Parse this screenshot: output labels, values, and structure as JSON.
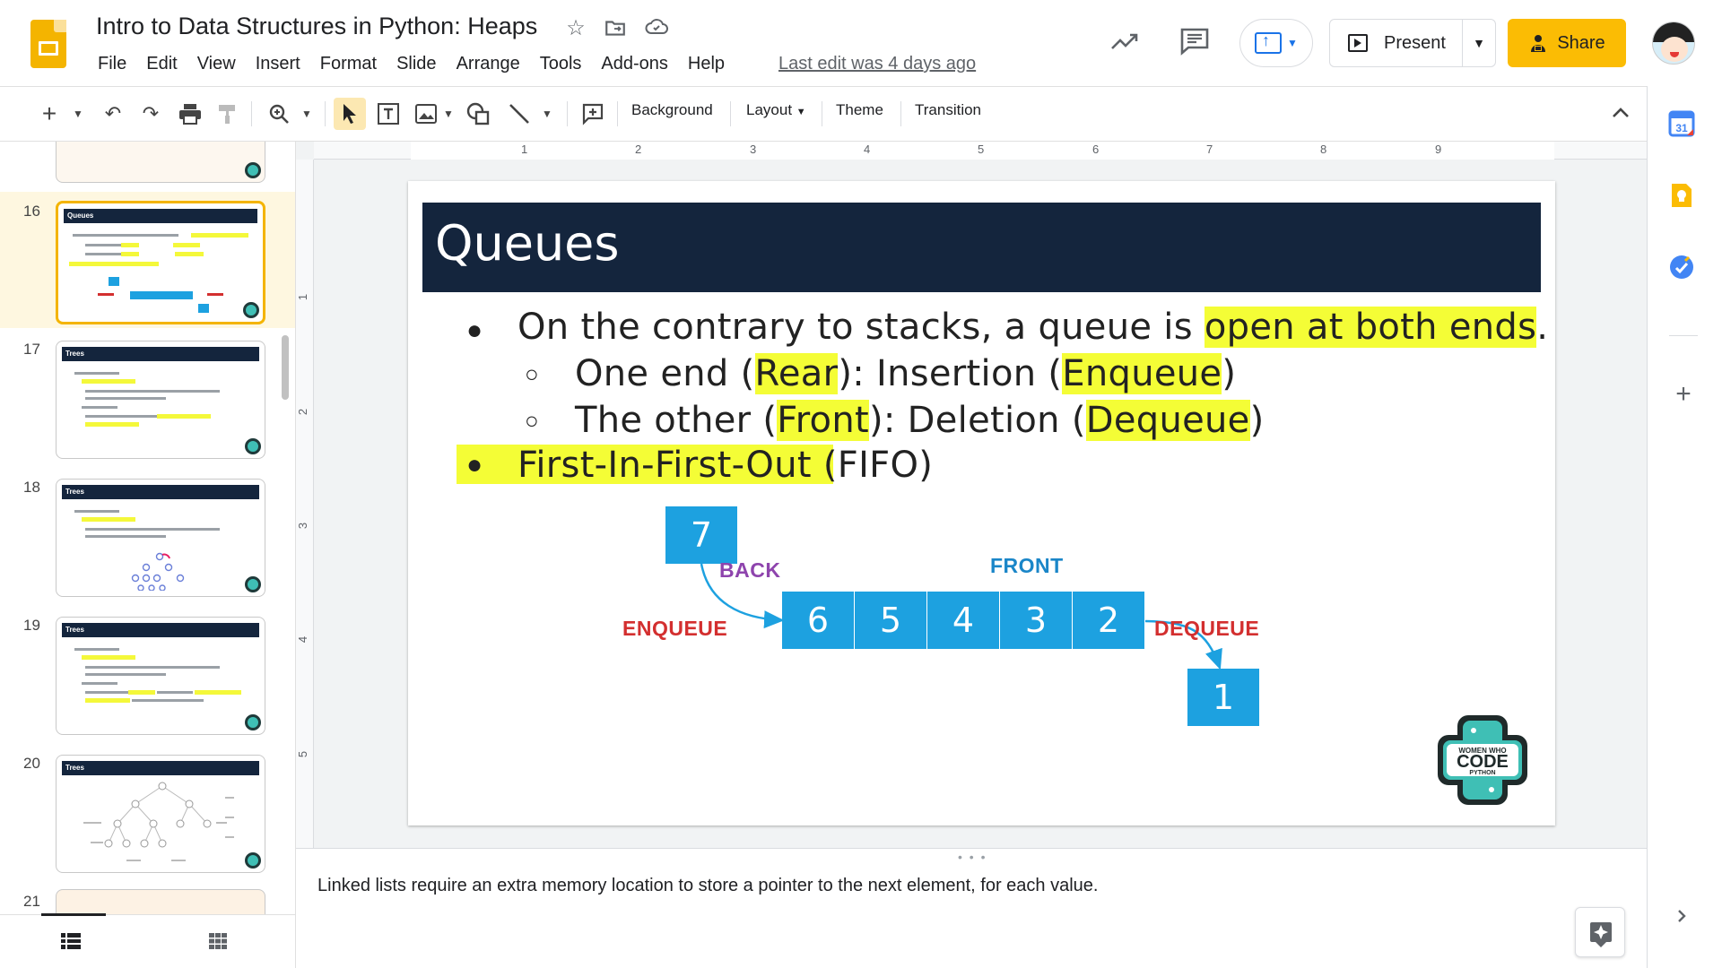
{
  "header": {
    "doc_title": "Intro to Data Structures in Python: Heaps",
    "menu": [
      "File",
      "Edit",
      "View",
      "Insert",
      "Format",
      "Slide",
      "Arrange",
      "Tools",
      "Add-ons",
      "Help"
    ],
    "last_edit": "Last edit was 4 days ago",
    "present_label": "Present",
    "share_label": "Share"
  },
  "toolbar": {
    "background_label": "Background",
    "layout_label": "Layout",
    "theme_label": "Theme",
    "transition_label": "Transition"
  },
  "filmstrip": {
    "slides": [
      {
        "number": "16",
        "title": "Queues"
      },
      {
        "number": "17",
        "title": "Trees"
      },
      {
        "number": "18",
        "title": "Trees"
      },
      {
        "number": "19",
        "title": "Trees"
      },
      {
        "number": "20",
        "title": "Trees"
      },
      {
        "number": "21",
        "title": ""
      }
    ]
  },
  "ruler": {
    "h": [
      "1",
      "2",
      "3",
      "4",
      "5",
      "6",
      "7",
      "8",
      "9"
    ],
    "v": [
      "1",
      "2",
      "3",
      "4",
      "5"
    ]
  },
  "slide": {
    "title": "Queues",
    "bullet1": {
      "pre": "On the contrary to stacks, a queue is ",
      "hl": "open at both ends",
      "post": "."
    },
    "sub1": {
      "a": "One end (",
      "b": "Rear",
      "c": "): Insertion (",
      "d": "Enqueue",
      "e": ")"
    },
    "sub2": {
      "a": "The other (",
      "b": "Front",
      "c": "): Deletion (",
      "d": "Dequeue",
      "e": ")"
    },
    "bullet2": "First-In-First-Out (FIFO)",
    "diagram": {
      "incoming": "7",
      "queue": [
        "6",
        "5",
        "4",
        "3",
        "2"
      ],
      "outgoing": "1",
      "back_label": "BACK",
      "front_label": "FRONT",
      "enqueue_label": "ENQUEUE",
      "dequeue_label": "DEQUEUE"
    },
    "logo": {
      "line1": "WOMEN WHO",
      "line2": "CODE",
      "line3": "PYTHON"
    }
  },
  "notes": {
    "text": "Linked lists require an extra memory location to store a pointer to the next element, for each value."
  },
  "colors": {
    "accent_yellow": "#fbbc04",
    "title_bar": "#14253d",
    "highlight": "#f4fd36",
    "queue_blue": "#1da1e0",
    "back_purple": "#8e44ad",
    "front_blue": "#1a86c8",
    "op_red": "#d32f2f"
  }
}
